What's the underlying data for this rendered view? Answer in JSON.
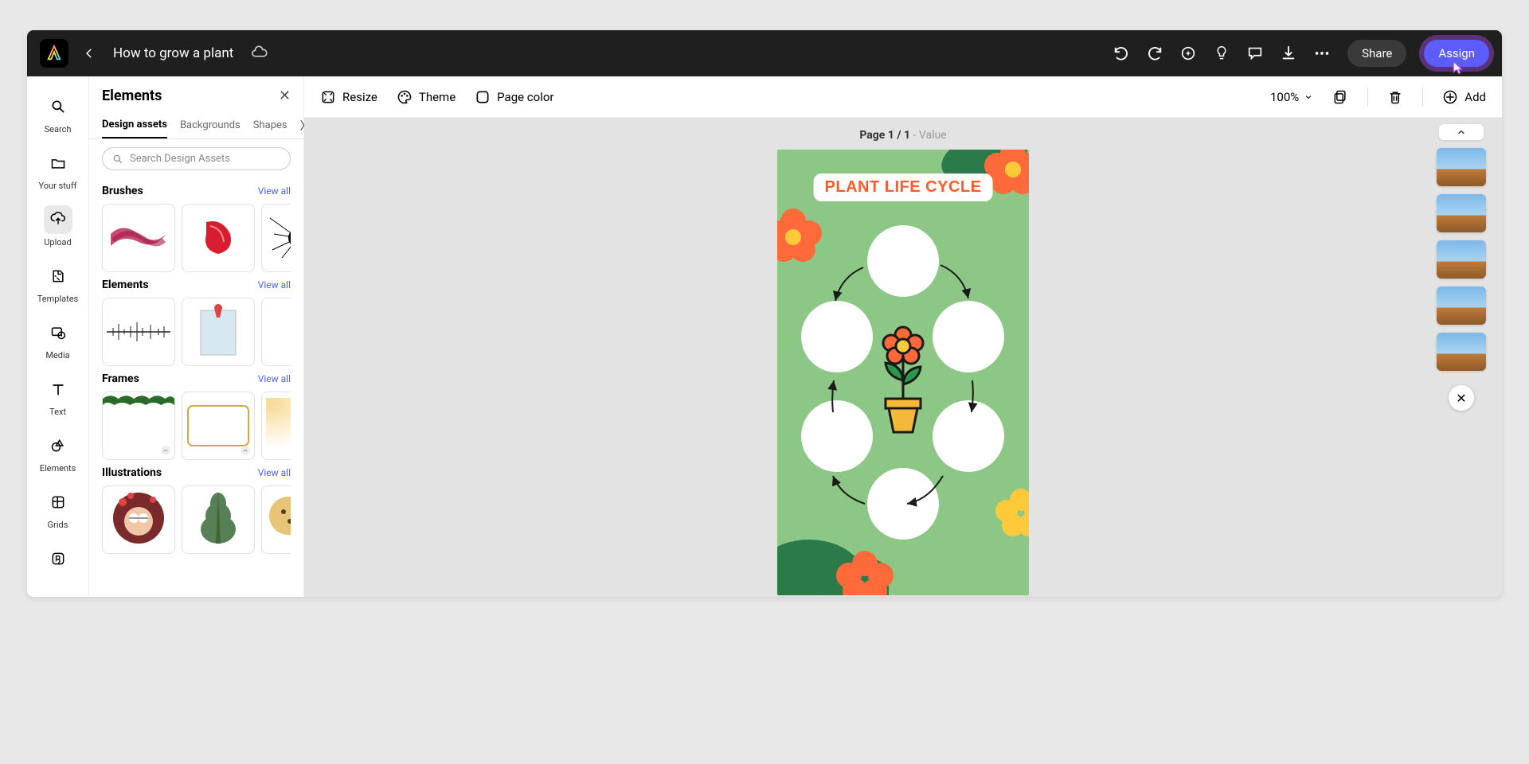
{
  "header": {
    "doc_title": "How to grow a plant",
    "share_label": "Share",
    "assign_label": "Assign"
  },
  "rail": {
    "items": [
      {
        "id": "search",
        "label": "Search"
      },
      {
        "id": "your-stuff",
        "label": "Your stuff"
      },
      {
        "id": "upload",
        "label": "Upload"
      },
      {
        "id": "templates",
        "label": "Templates"
      },
      {
        "id": "media",
        "label": "Media"
      },
      {
        "id": "text",
        "label": "Text"
      },
      {
        "id": "elements",
        "label": "Elements"
      },
      {
        "id": "grids",
        "label": "Grids"
      }
    ]
  },
  "panel": {
    "title": "Elements",
    "tabs": [
      "Design assets",
      "Backgrounds",
      "Shapes"
    ],
    "active_tab": 0,
    "search_placeholder": "Search Design Assets",
    "view_all_label": "View all",
    "sections": [
      {
        "title": "Brushes"
      },
      {
        "title": "Elements"
      },
      {
        "title": "Frames"
      },
      {
        "title": "Illustrations"
      }
    ]
  },
  "toolbar": {
    "resize_label": "Resize",
    "theme_label": "Theme",
    "page_color_label": "Page color",
    "zoom_label": "100%",
    "add_label": "Add"
  },
  "canvas": {
    "page_label_prefix": "Page 1 / 1",
    "page_label_suffix": " - Value",
    "artwork_title": "PLANT LIFE CYCLE"
  },
  "page_thumbs": {
    "count": 5
  }
}
